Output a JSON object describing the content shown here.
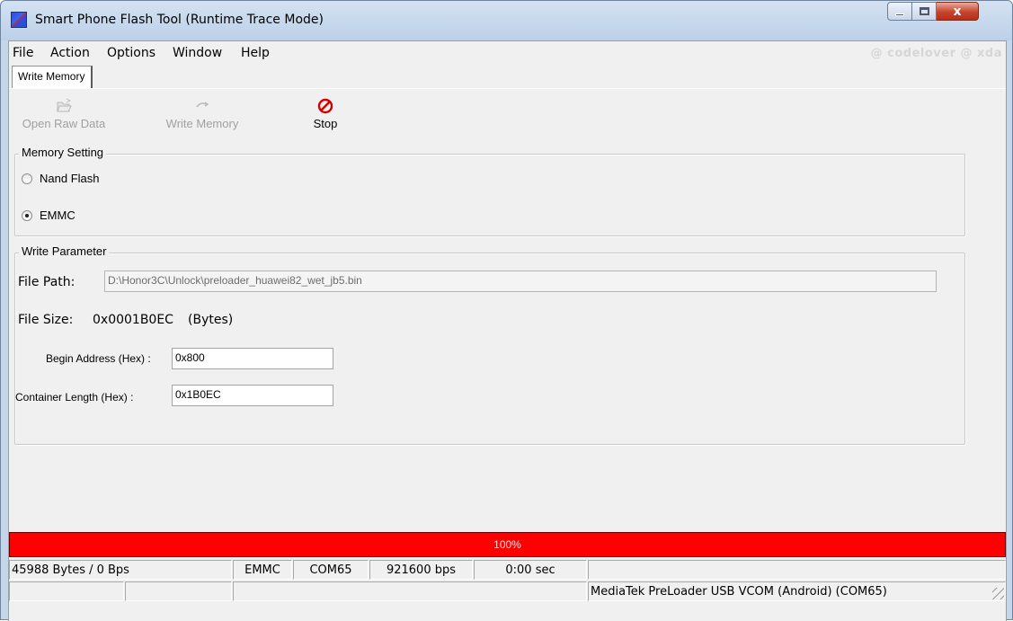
{
  "window": {
    "title": "Smart Phone Flash Tool (Runtime Trace Mode)",
    "close_glyph": "x"
  },
  "menu": {
    "items": [
      "File",
      "Action",
      "Options",
      "Window",
      "Help"
    ],
    "watermark": "@ codelover @ xda"
  },
  "tabs": [
    {
      "label": "Write Memory",
      "active": true
    }
  ],
  "toolbar": {
    "open_raw_data": {
      "label": "Open Raw Data",
      "icon": "folder-open-icon",
      "enabled": false
    },
    "write_memory": {
      "label": "Write Memory",
      "icon": "write-arrow-icon",
      "enabled": false
    },
    "stop": {
      "label": "Stop",
      "icon": "stop-icon",
      "enabled": true,
      "color": "#d40000"
    }
  },
  "memory_setting": {
    "legend": "Memory Setting",
    "options": [
      {
        "label": "Nand Flash",
        "checked": false
      },
      {
        "label": "EMMC",
        "checked": true
      }
    ]
  },
  "write_parameter": {
    "legend": "Write Parameter",
    "file_path_label": "File Path:",
    "file_path_value": "D:\\Honor3C\\Unlock\\preloader_huawei82_wet_jb5.bin",
    "file_size_label": "File Size:",
    "file_size_value": "0x0001B0EC",
    "file_size_unit": "(Bytes)",
    "begin_address_label": "Begin Address (Hex) :",
    "begin_address_value": "0x800",
    "container_length_label": "Container Length (Hex) :",
    "container_length_value": "0x1B0EC"
  },
  "progress": {
    "percent": 100,
    "text": "100%",
    "color": "#ff0000"
  },
  "status": {
    "row1": [
      "45988 Bytes / 0 Bps",
      "EMMC",
      "COM65",
      "921600 bps",
      "0:00 sec",
      ""
    ],
    "row2": [
      "",
      "",
      "",
      "MediaTek PreLoader USB VCOM (Android) (COM65)"
    ]
  }
}
